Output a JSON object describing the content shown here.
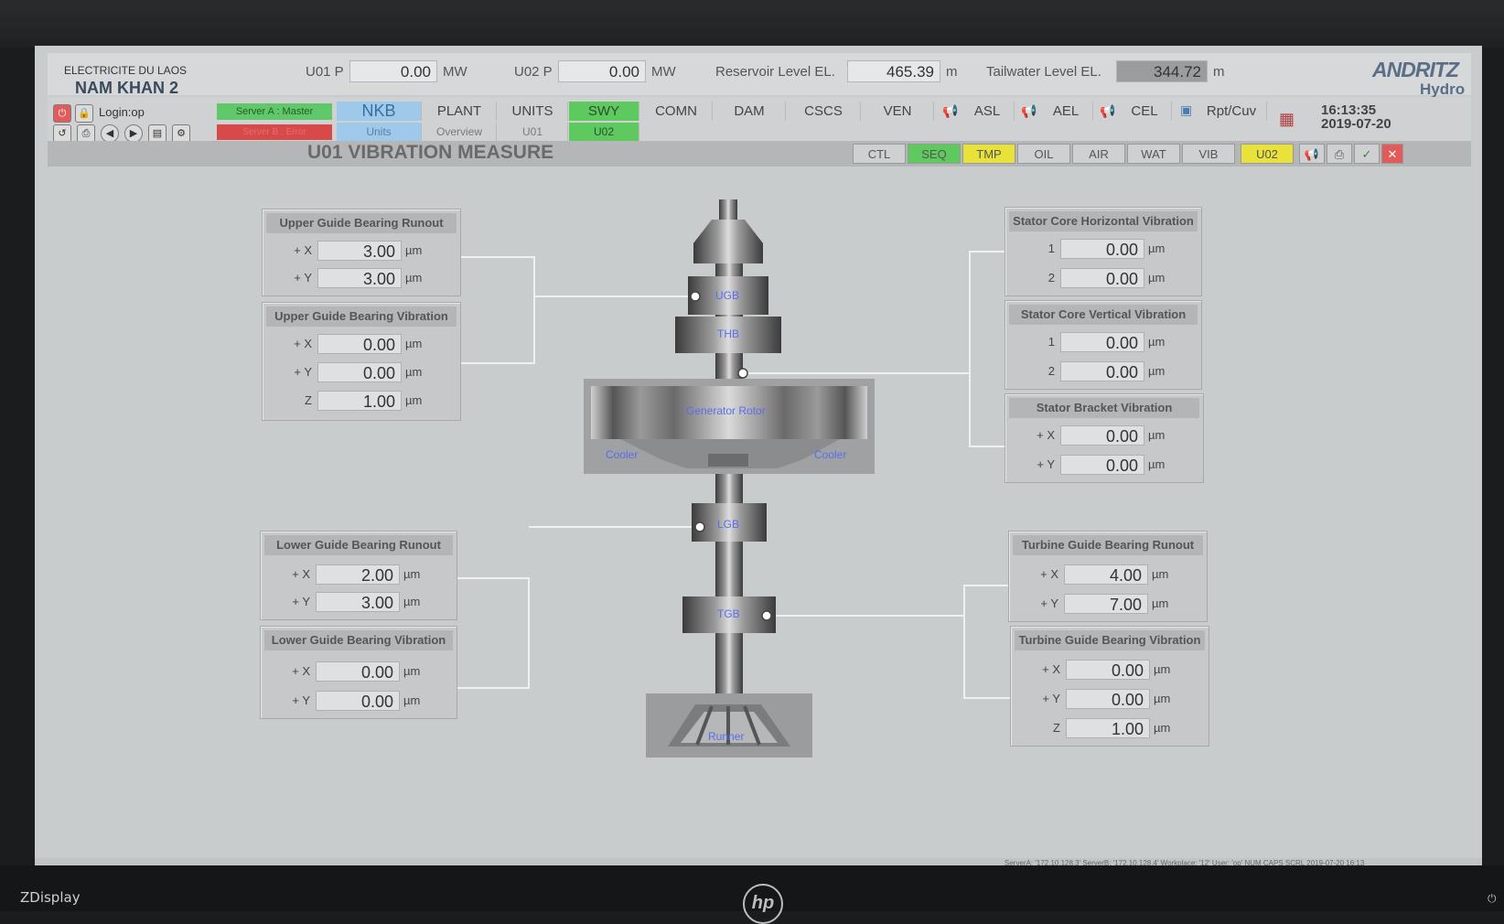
{
  "header": {
    "company": "ELECTRICITE DU LAOS",
    "plant": "NAM KHAN 2",
    "u01p_label": "U01 P",
    "u01p_value": "0.00",
    "u01p_unit": "MW",
    "u02p_label": "U02 P",
    "u02p_value": "0.00",
    "u02p_unit": "MW",
    "reservoir_label": "Reservoir Level EL.",
    "reservoir_value": "465.39",
    "reservoir_unit": "m",
    "tailwater_label": "Tailwater Level EL.",
    "tailwater_value": "344.72",
    "tailwater_unit": "m",
    "logo_line1": "ANDRITZ",
    "logo_line2": "Hydro"
  },
  "nav": {
    "login": "Login:op",
    "server_a": "Server A : Master",
    "server_b": "Server B : Error",
    "tabs": [
      "NKB",
      "PLANT",
      "UNITS",
      "SWY",
      "COMN",
      "DAM",
      "CSCS",
      "VEN",
      "ASL",
      "AEL",
      "CEL",
      "Rpt/Cuv"
    ],
    "subtabs": [
      "Units",
      "Overview",
      "U01",
      "U02"
    ],
    "time": "16:13:35",
    "date": "2019-07-20",
    "colors": {
      "active_blue": "#9ec9ea",
      "green": "#5ec95e",
      "yellow": "#e8e23a",
      "red": "#d84a4a"
    }
  },
  "page": {
    "title": "U01 VIBRATION MEASURE",
    "system_tabs": [
      "CTL",
      "SEQ",
      "TMP",
      "OIL",
      "AIR",
      "WAT",
      "VIB",
      "U02"
    ]
  },
  "panels": {
    "ugb_runout": {
      "title": "Upper Guide Bearing Runout",
      "rows": [
        {
          "label": "+ X",
          "value": "3.00",
          "unit": "µm"
        },
        {
          "label": "+ Y",
          "value": "3.00",
          "unit": "µm"
        }
      ]
    },
    "ugb_vibration": {
      "title": "Upper Guide Bearing Vibration",
      "rows": [
        {
          "label": "+ X",
          "value": "0.00",
          "unit": "µm"
        },
        {
          "label": "+ Y",
          "value": "0.00",
          "unit": "µm"
        },
        {
          "label": "Z",
          "value": "1.00",
          "unit": "µm"
        }
      ]
    },
    "lgb_runout": {
      "title": "Lower Guide Bearing Runout",
      "rows": [
        {
          "label": "+ X",
          "value": "2.00",
          "unit": "µm"
        },
        {
          "label": "+ Y",
          "value": "3.00",
          "unit": "µm"
        }
      ]
    },
    "lgb_vibration": {
      "title": "Lower Guide Bearing Vibration",
      "rows": [
        {
          "label": "+ X",
          "value": "0.00",
          "unit": "µm"
        },
        {
          "label": "+ Y",
          "value": "0.00",
          "unit": "µm"
        }
      ]
    },
    "stator_h": {
      "title": "Stator Core Horizontal Vibration",
      "rows": [
        {
          "label": "1",
          "value": "0.00",
          "unit": "µm"
        },
        {
          "label": "2",
          "value": "0.00",
          "unit": "µm"
        }
      ]
    },
    "stator_v": {
      "title": "Stator Core Vertical Vibration",
      "rows": [
        {
          "label": "1",
          "value": "0.00",
          "unit": "µm"
        },
        {
          "label": "2",
          "value": "0.00",
          "unit": "µm"
        }
      ]
    },
    "stator_bracket": {
      "title": "Stator Bracket Vibration",
      "rows": [
        {
          "label": "+ X",
          "value": "0.00",
          "unit": "µm"
        },
        {
          "label": "+ Y",
          "value": "0.00",
          "unit": "µm"
        }
      ]
    },
    "tgb_runout": {
      "title": "Turbine Guide Bearing Runout",
      "rows": [
        {
          "label": "+ X",
          "value": "4.00",
          "unit": "µm"
        },
        {
          "label": "+ Y",
          "value": "7.00",
          "unit": "µm"
        }
      ]
    },
    "tgb_vibration": {
      "title": "Turbine Guide Bearing Vibration",
      "rows": [
        {
          "label": "+ X",
          "value": "0.00",
          "unit": "µm"
        },
        {
          "label": "+ Y",
          "value": "0.00",
          "unit": "µm"
        },
        {
          "label": "Z",
          "value": "1.00",
          "unit": "µm"
        }
      ]
    }
  },
  "machine": {
    "ugb": "UGB",
    "thb": "THB",
    "rotor": "Generator Rotor",
    "cooler_left": "Cooler",
    "cooler_right": "Cooler",
    "lgb": "LGB",
    "tgb": "TGB",
    "runner": "Runner"
  },
  "statusbar": "ServerA: '172.10.128.3'  ServerB: '172.10.128.4'  Workplace: '12'  User: 'op'  NUM  CAPS  SCRL  2019-07-20  16:13",
  "monitor": {
    "brand": "ZDisplay",
    "logo": "hp"
  }
}
